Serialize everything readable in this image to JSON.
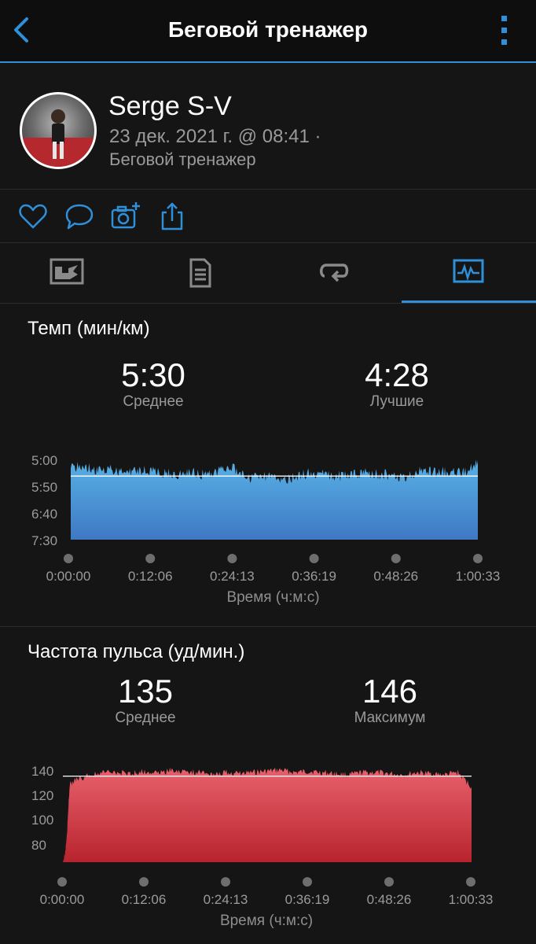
{
  "header": {
    "title": "Беговой тренажер"
  },
  "profile": {
    "name": "Serge S-V",
    "date_line": "23 дек. 2021 г. @ 08:41 ·",
    "activity": "Беговой тренажер"
  },
  "accent_color": "#2f8fd8",
  "icons": {
    "back": "chevron-left-icon",
    "more": "more-vertical-icon",
    "like": "heart-icon",
    "comment": "comment-icon",
    "photo": "camera-add-icon",
    "share": "share-icon",
    "tabs": [
      "map-overview-icon",
      "details-list-icon",
      "laps-icon",
      "charts-icon"
    ]
  },
  "active_tab_index": 3,
  "pace_section": {
    "title": "Темп (мин/км)",
    "avg_value": "5:30",
    "avg_label": "Среднее",
    "best_value": "4:28",
    "best_label": "Лучшие"
  },
  "hr_section": {
    "title": "Частота пульса (уд/мин.)",
    "avg_value": "135",
    "avg_label": "Среднее",
    "max_value": "146",
    "max_label": "Максимум"
  },
  "chart_data": [
    {
      "type": "area",
      "color": "#4fa6dc",
      "xlabel": "Время (ч:м:с)",
      "x_ticks": [
        "0:00:00",
        "0:12:06",
        "0:24:13",
        "0:36:19",
        "0:48:26",
        "1:00:33"
      ],
      "y_ticks": [
        "5:00",
        "5:50",
        "6:40",
        "7:30"
      ],
      "average_line": "5:30",
      "x_minutes": [
        0,
        2,
        4,
        6,
        8,
        10,
        12,
        14,
        16,
        18,
        20,
        22,
        24,
        26,
        28,
        30,
        32,
        34,
        36,
        38,
        40,
        42,
        44,
        46,
        48,
        50,
        52,
        54,
        56,
        58,
        60
      ],
      "pace_min_per_km": [
        5.2,
        5.2,
        5.35,
        5.3,
        5.4,
        5.3,
        5.35,
        5.4,
        5.45,
        5.35,
        5.5,
        5.3,
        5.25,
        5.6,
        5.5,
        5.55,
        5.6,
        5.45,
        5.4,
        5.5,
        5.5,
        5.45,
        5.4,
        5.45,
        5.5,
        5.5,
        5.3,
        5.4,
        5.35,
        5.4,
        5.0
      ]
    },
    {
      "type": "area",
      "color": "#d8434f",
      "xlabel": "Время (ч:м:с)",
      "x_ticks": [
        "0:00:00",
        "0:12:06",
        "0:24:13",
        "0:36:19",
        "0:48:26",
        "1:00:33"
      ],
      "y_ticks": [
        "140",
        "120",
        "100",
        "80"
      ],
      "average_line": 135,
      "x_minutes": [
        0,
        0.5,
        1,
        2,
        4,
        6,
        8,
        10,
        12,
        14,
        16,
        18,
        20,
        22,
        24,
        26,
        28,
        30,
        32,
        34,
        36,
        38,
        40,
        42,
        44,
        46,
        48,
        50,
        52,
        54,
        56,
        58,
        60
      ],
      "bpm": [
        65,
        80,
        130,
        134,
        138,
        140,
        140,
        139,
        141,
        140,
        142,
        141,
        140,
        139,
        140,
        139,
        140,
        141,
        142,
        140,
        141,
        140,
        139,
        138,
        140,
        140,
        139,
        138,
        140,
        139,
        138,
        140,
        128
      ]
    }
  ]
}
